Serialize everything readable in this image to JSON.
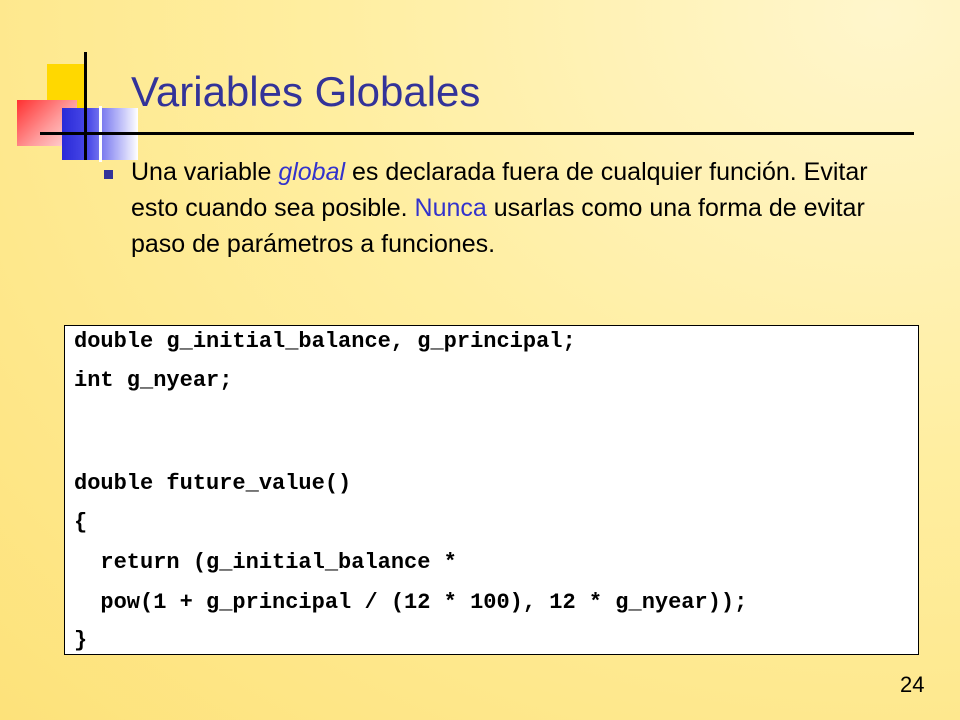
{
  "slide": {
    "title": "Variables Globales",
    "bullet": {
      "before_em": "Una variable ",
      "em_word": "global",
      "between": " es declarada fuera de cualquier función. Evitar esto cuando sea posible. ",
      "highlight_word": "Nunca",
      "after": " usarlas como una forma de evitar paso de parámetros a funciones."
    },
    "code_lines": [
      "double g_initial_balance, g_principal;",
      "int g_nyear;",
      "double future_value()",
      "{",
      "  return (g_initial_balance *",
      "  pow(1 + g_principal / (12 * 100), 12 * g_nyear));",
      "}"
    ],
    "page_number": "24",
    "colors": {
      "title": "#333399",
      "highlight": "#3333cc",
      "background": "#ffeea0"
    }
  }
}
